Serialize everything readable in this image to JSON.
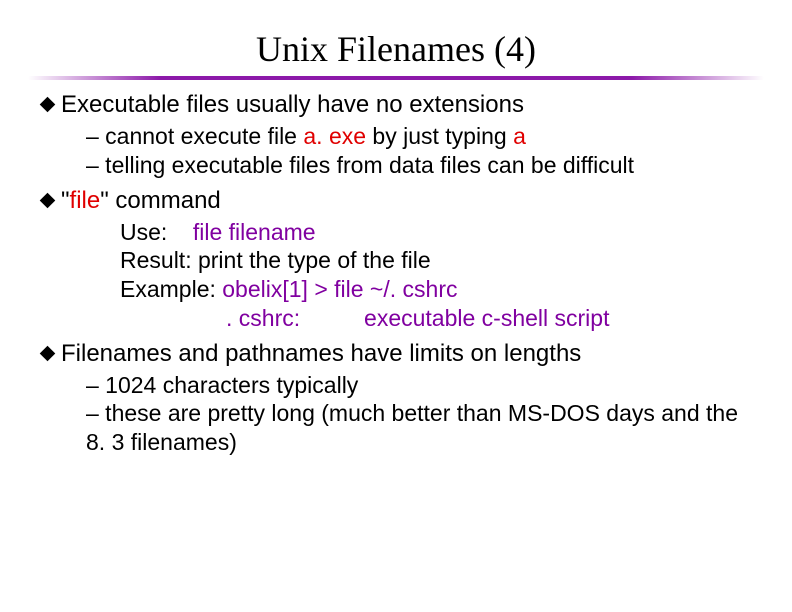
{
  "title": "Unix Filenames (4)",
  "bullets": {
    "b1": {
      "text_a": "Executable files usually have no extensions",
      "sub1_a": "– cannot execute file ",
      "sub1_red1": "a. exe",
      "sub1_b": " by just typing ",
      "sub1_red2": "a",
      "sub2": "– telling executable files from data files can be difficult"
    },
    "b2": {
      "quote_a": "\"",
      "file_word": "file",
      "text_b": "\" command",
      "sub1_a": "Use:    ",
      "sub1_purple": "file filename",
      "sub2": "Result: print the type of the file",
      "sub3_a": "Example: ",
      "sub3_purple": "obelix[1] > file ~/. cshrc",
      "sub4_purple": ". cshrc:          executable c-shell script"
    },
    "b3": {
      "text": "Filenames and pathnames have limits on lengths",
      "sub1": "– 1024 characters typically",
      "sub2": "– these are pretty long (much better than MS-DOS days and the 8. 3 filenames)"
    }
  }
}
